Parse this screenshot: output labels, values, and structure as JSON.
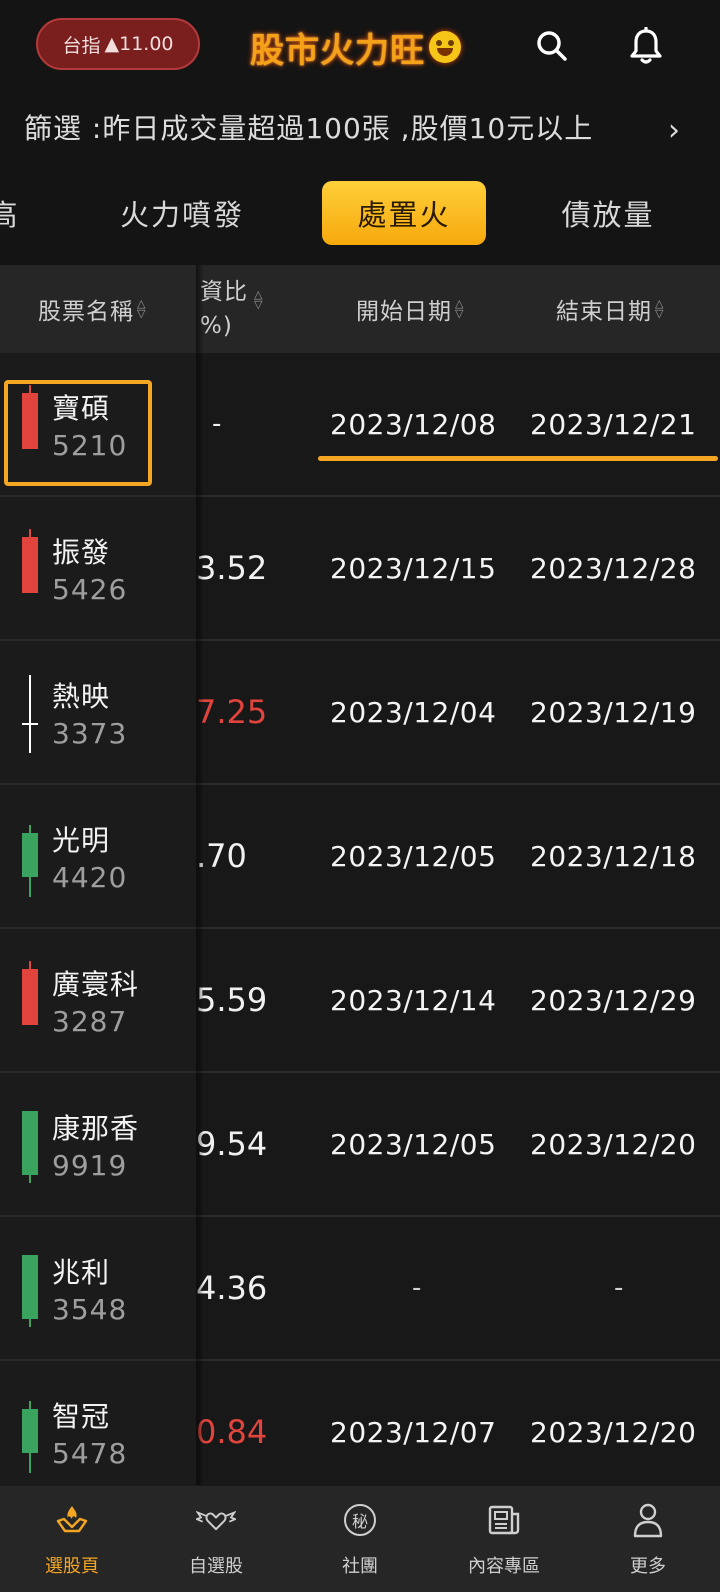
{
  "header": {
    "index_label": "台指",
    "index_change": "▲11.00",
    "logo_text": "股市火力旺",
    "icons": [
      "search-icon",
      "bell-icon",
      "grin-emoji-icon"
    ]
  },
  "filter": {
    "text": "篩選 :昨日成交量超過100張 ,股價10元以上",
    "arrow": "›"
  },
  "tabs": [
    {
      "label": "高",
      "active": false
    },
    {
      "label": "火力噴發",
      "active": false
    },
    {
      "label": "處置火",
      "active": true
    },
    {
      "label": "債放量",
      "active": false
    }
  ],
  "table": {
    "headers": {
      "name": "股票名稱",
      "ratio_line1": "資比",
      "ratio_line2": "%)",
      "start": "開始日期",
      "end": "結束日期"
    },
    "rows": [
      {
        "name": "寶碩",
        "code": "5210",
        "ratio": "-",
        "ratio_color": "white",
        "start": "2023/12/08",
        "end": "2023/12/21",
        "candle": "red"
      },
      {
        "name": "振發",
        "code": "5426",
        "ratio": "3.52",
        "ratio_color": "white",
        "start": "2023/12/15",
        "end": "2023/12/28",
        "candle": "red"
      },
      {
        "name": "熱映",
        "code": "3373",
        "ratio": "7.25",
        "ratio_color": "red",
        "start": "2023/12/04",
        "end": "2023/12/19",
        "candle": "cross"
      },
      {
        "name": "光明",
        "code": "4420",
        "ratio": ".70",
        "ratio_color": "white",
        "start": "2023/12/05",
        "end": "2023/12/18",
        "candle": "green"
      },
      {
        "name": "廣寰科",
        "code": "3287",
        "ratio": "5.59",
        "ratio_color": "white",
        "start": "2023/12/14",
        "end": "2023/12/29",
        "candle": "red"
      },
      {
        "name": "康那香",
        "code": "9919",
        "ratio": "9.54",
        "ratio_color": "white",
        "start": "2023/12/05",
        "end": "2023/12/20",
        "candle": "green"
      },
      {
        "name": "兆利",
        "code": "3548",
        "ratio": "4.36",
        "ratio_color": "white",
        "start": "-",
        "end": "-",
        "candle": "green"
      },
      {
        "name": "智冠",
        "code": "5478",
        "ratio": "0.84",
        "ratio_color": "red",
        "start": "2023/12/07",
        "end": "2023/12/20",
        "candle": "green"
      }
    ]
  },
  "bottom_nav": [
    {
      "label": "選股頁",
      "icon": "fire-hand-icon",
      "active": true
    },
    {
      "label": "自選股",
      "icon": "heart-wings-icon",
      "active": false
    },
    {
      "label": "社團",
      "icon": "secret-badge-icon",
      "badge_char": "秘",
      "active": false
    },
    {
      "label": "內容專區",
      "icon": "newspaper-icon",
      "active": false
    },
    {
      "label": "更多",
      "icon": "person-icon",
      "active": false
    }
  ],
  "colors": {
    "accent": "#f5a623",
    "red": "#e0443c",
    "green": "#3aa35f",
    "background": "#141414"
  }
}
